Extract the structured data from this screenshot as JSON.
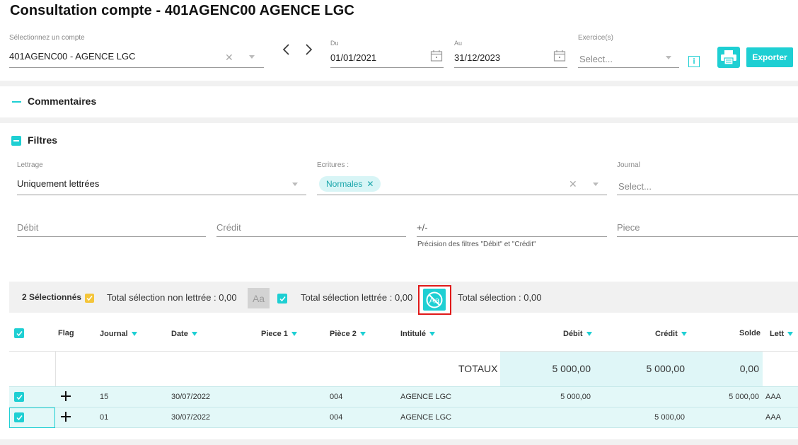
{
  "header": {
    "title": "Consultation compte - 401AGENC00 AGENCE LGC"
  },
  "account": {
    "label": "Sélectionnez un compte",
    "value": "401AGENC00 - AGENCE LGC"
  },
  "date_from": {
    "label": "Du",
    "value": "01/01/2021"
  },
  "date_to": {
    "label": "Au",
    "value": "31/12/2023"
  },
  "exercice": {
    "label": "Exercice(s)",
    "placeholder": "Select..."
  },
  "actions": {
    "export_label": "Exporter"
  },
  "commentaires": {
    "title": "Commentaires"
  },
  "filtres": {
    "title": "Filtres",
    "lettrage": {
      "label": "Lettrage",
      "value": "Uniquement lettrées"
    },
    "ecritures": {
      "label": "Ecritures :",
      "chip": "Normales"
    },
    "journal": {
      "label": "Journal",
      "placeholder": "Select..."
    },
    "debit": {
      "placeholder": "Débit"
    },
    "credit": {
      "placeholder": "Crédit"
    },
    "plusminus": {
      "placeholder": "+/-",
      "help": "Précision des filtres \"Débit\" et \"Crédit\""
    },
    "piece": {
      "placeholder": "Piece"
    }
  },
  "selection": {
    "count": "2 Sélectionnés",
    "non_lettree": "Total sélection non lettrée : 0,00",
    "non_lettree_btn": "Aa",
    "lettree": "Total sélection lettrée : 0,00",
    "total": "Total sélection : 0,00"
  },
  "table": {
    "headers": {
      "flag": "Flag",
      "journal": "Journal",
      "date": "Date",
      "piece1": "Piece 1",
      "piece2": "Pièce 2",
      "intitule": "Intitulé",
      "debit": "Débit",
      "credit": "Crédit",
      "solde": "Solde",
      "lett": "Lett"
    },
    "totals": {
      "label": "TOTAUX",
      "debit": "5 000,00",
      "credit": "5 000,00",
      "solde": "0,00"
    },
    "rows": [
      {
        "journal": "15",
        "date": "30/07/2022",
        "piece1": "",
        "piece2": "004",
        "intitule": "AGENCE LGC",
        "debit": "5 000,00",
        "credit": "",
        "solde": "5 000,00",
        "lett": "AAA"
      },
      {
        "journal": "01",
        "date": "30/07/2022",
        "piece1": "",
        "piece2": "004",
        "intitule": "AGENCE LGC",
        "debit": "",
        "credit": "5 000,00",
        "solde": "",
        "lett": "AAA"
      }
    ]
  },
  "colors": {
    "accent": "#1ecfd3",
    "row_bg": "#e3f8f8",
    "highlight_border": "#e01919",
    "yellow": "#f4c53a"
  }
}
